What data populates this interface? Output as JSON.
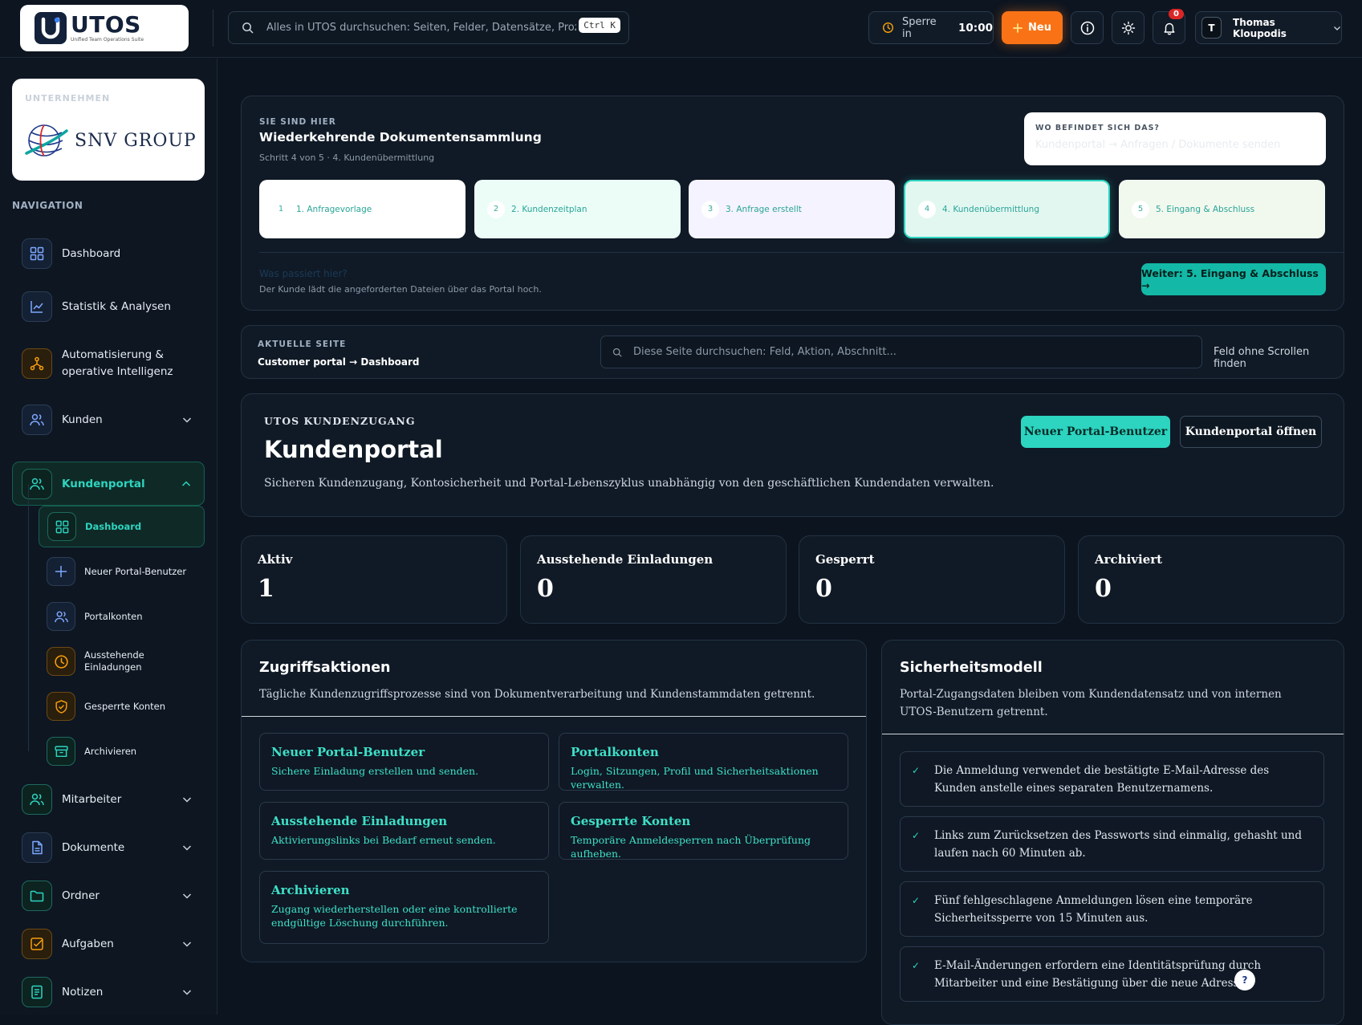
{
  "topbar": {
    "logo_name": "UTOS",
    "logo_sub": "Unified Team Operations Suite",
    "search_placeholder": "Alles in UTOS durchsuchen: Seiten, Felder, Datensätze, Prozesse",
    "search_shortcut": "Ctrl K",
    "lock_label": "Sperre in",
    "lock_time": "10:00",
    "new_label": "Neu",
    "notification_count": "0",
    "user_initial": "T",
    "user_name": "Thomas Kloupodis"
  },
  "sidebar": {
    "company_label": "UNTERNEHMEN",
    "company_name": "SNV GROUP",
    "nav_label": "NAVIGATION",
    "items": [
      {
        "label": "Dashboard",
        "icon": "grid-icon"
      },
      {
        "label": "Statistik & Analysen",
        "icon": "chart-line-icon"
      },
      {
        "label": "Automatisierung & operative Intelligenz",
        "icon": "workflow-icon"
      },
      {
        "label": "Kunden",
        "icon": "users-icon"
      },
      {
        "label": "Kundenportal",
        "icon": "users-icon"
      },
      {
        "label": "Mitarbeiter",
        "icon": "users-icon"
      },
      {
        "label": "Dokumente",
        "icon": "document-icon"
      },
      {
        "label": "Ordner",
        "icon": "folder-icon"
      },
      {
        "label": "Aufgaben",
        "icon": "checkbox-icon"
      },
      {
        "label": "Notizen",
        "icon": "note-icon"
      }
    ],
    "subitems": [
      {
        "label": "Dashboard",
        "icon": "grid-icon"
      },
      {
        "label": "Neuer Portal-Benutzer",
        "icon": "plus-icon"
      },
      {
        "label": "Portalkonten",
        "icon": "users-icon"
      },
      {
        "label": "Ausstehende Einladungen",
        "icon": "clock-icon"
      },
      {
        "label": "Gesperrte Konten",
        "icon": "shield-check-icon"
      },
      {
        "label": "Archivieren",
        "icon": "archive-icon"
      }
    ]
  },
  "workflow": {
    "kicker": "SIE SIND HIER",
    "title": "Wiederkehrende Dokumentensammlung",
    "subtitle": "Schritt 4 von 5 · 4. Kundenübermittlung",
    "where_label": "WO BEFINDET SICH DAS?",
    "where_value": "Kundenportal → Anfragen / Dokumente senden",
    "steps": [
      {
        "num": "1",
        "label": "1. Anfragevorlage",
        "bg": "#ffffff"
      },
      {
        "num": "2",
        "label": "2. Kundenzeitplan",
        "bg": "#ecfdf8"
      },
      {
        "num": "3",
        "label": "3. Anfrage erstellt",
        "bg": "#f5f3ff"
      },
      {
        "num": "4",
        "label": "4. Kundenübermittlung",
        "bg": "#e3f7f1"
      },
      {
        "num": "5",
        "label": "5. Eingang & Abschluss",
        "bg": "#f1f8ee"
      }
    ],
    "current_step": 4,
    "what_label": "Was passiert hier?",
    "what_value": "Der Kunde lädt die angeforderten Dateien über das Portal hoch.",
    "next_label": "Weiter: 5. Eingang & Abschluss →"
  },
  "current_page": {
    "kicker": "AKTUELLE SEITE",
    "path": "Customer portal → Dashboard",
    "search_placeholder": "Diese Seite durchsuchen: Feld, Aktion, Abschnitt...",
    "find_label": "Feld ohne Scrollen finden"
  },
  "hero": {
    "kicker": "UTOS KUNDENZUGANG",
    "title": "Kundenportal",
    "description": "Sicheren Kundenzugang, Kontosicherheit und Portal-Lebenszyklus unabhängig von den geschäftlichen Kundendaten verwalten.",
    "primary_label": "Neuer Portal-Benutzer",
    "secondary_label": "Kundenportal öffnen"
  },
  "stats": [
    {
      "label": "Aktiv",
      "value": "1"
    },
    {
      "label": "Ausstehende Einladungen",
      "value": "0"
    },
    {
      "label": "Gesperrt",
      "value": "0"
    },
    {
      "label": "Archiviert",
      "value": "0"
    }
  ],
  "access": {
    "title": "Zugriffsaktionen",
    "description": "Tägliche Kundenzugriffsprozesse sind von Dokumentverarbeitung und Kundenstammdaten getrennt.",
    "actions": [
      {
        "title": "Neuer Portal-Benutzer",
        "desc": "Sichere Einladung erstellen und senden."
      },
      {
        "title": "Portalkonten",
        "desc": "Login, Sitzungen, Profil und Sicherheitsaktionen verwalten."
      },
      {
        "title": "Ausstehende Einladungen",
        "desc": "Aktivierungslinks bei Bedarf erneut senden."
      },
      {
        "title": "Gesperrte Konten",
        "desc": "Temporäre Anmeldesperren nach Überprüfung aufheben."
      },
      {
        "title": "Archivieren",
        "desc": "Zugang wiederherstellen oder eine kontrollierte endgültige Löschung durchführen."
      }
    ]
  },
  "security": {
    "title": "Sicherheitsmodell",
    "description": "Portal-Zugangsdaten bleiben vom Kundendatensatz und von internen UTOS-Benutzern getrennt.",
    "rules": [
      "Die Anmeldung verwendet die bestätigte E-Mail-Adresse des Kunden anstelle eines separaten Benutzernamens.",
      "Links zum Zurücksetzen des Passworts sind einmalig, gehasht und laufen nach 60 Minuten ab.",
      "Fünf fehlgeschlagene Anmeldungen lösen eine temporäre Sicherheitssperre von 15 Minuten aus.",
      "E-Mail-Änderungen erfordern eine Identitätsprüfung durch Mitarbeiter und eine Bestätigung über die neue Adresse."
    ]
  },
  "help_label": "?"
}
